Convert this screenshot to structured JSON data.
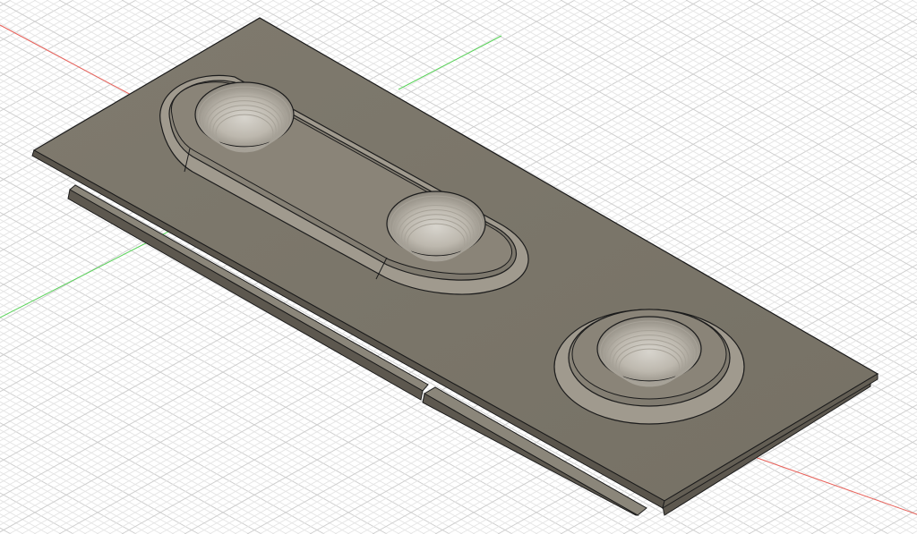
{
  "viewport": {
    "background": "#ffffff",
    "grid": {
      "enabled": true,
      "style": "isometric",
      "minor_color": "#e6e6e6",
      "major_color": "#cfcfcf"
    },
    "axes": {
      "x_color": "#e8615a",
      "y_color": "#5ad35a"
    }
  },
  "model": {
    "body_color": "#7d776b",
    "body_dark": "#5e594f",
    "boss_color": "#8a8478",
    "hole_color": "#b9b5ad",
    "edge_color": "#1c1c1c",
    "features": [
      "base-plate",
      "slot-boss",
      "round-boss",
      "threaded-hole",
      "threaded-hole",
      "threaded-hole",
      "bottom-rail-left",
      "bottom-rail-right"
    ]
  }
}
